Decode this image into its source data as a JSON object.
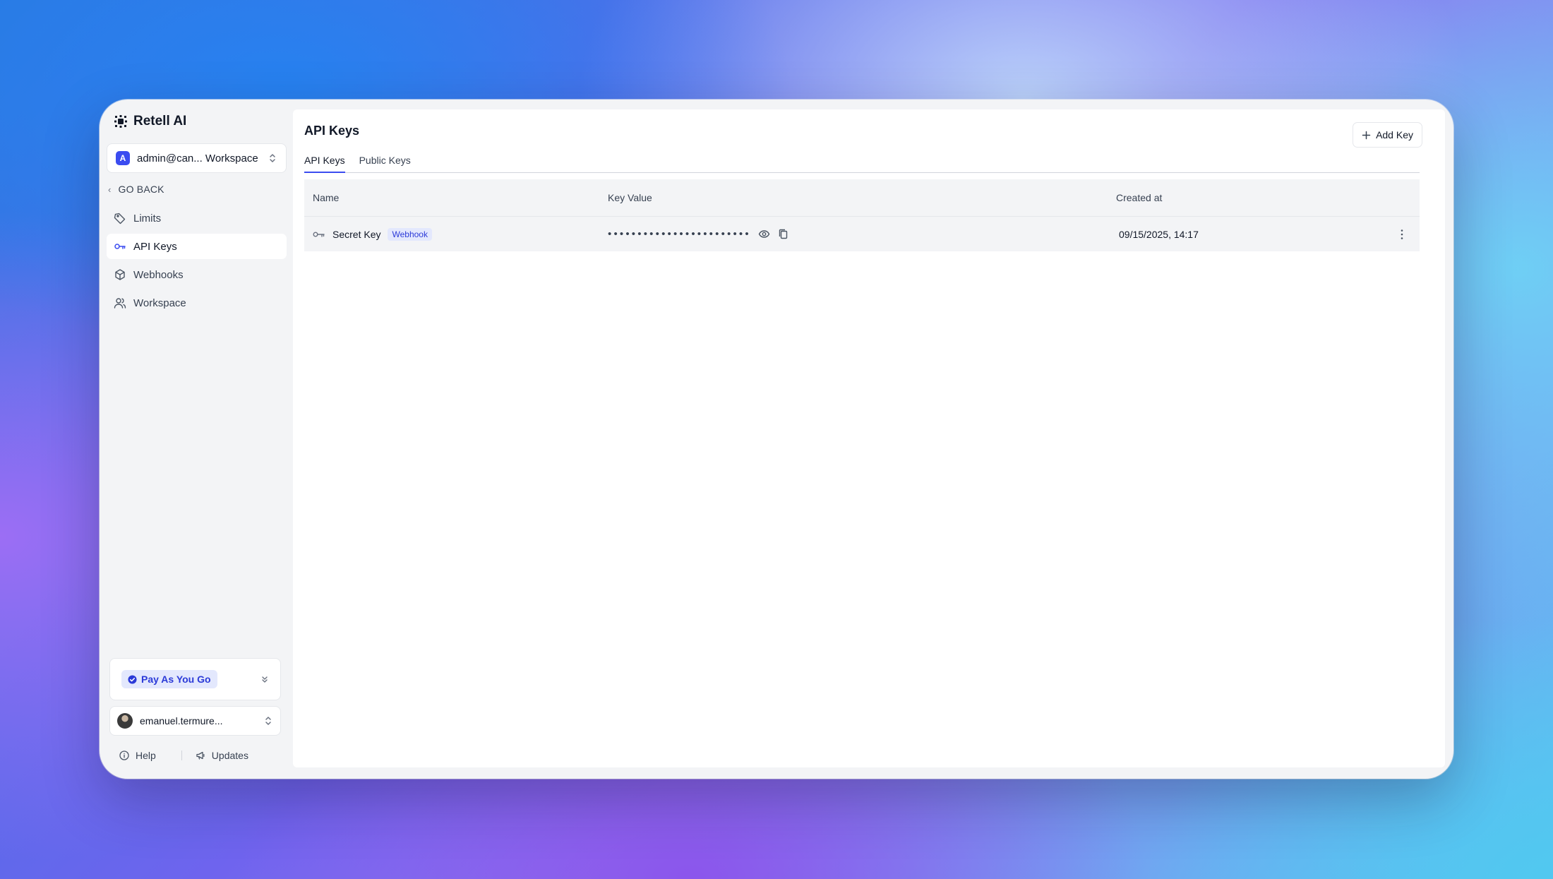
{
  "app": {
    "name": "Retell AI"
  },
  "workspace": {
    "avatar_letter": "A",
    "label": "admin@can... Workspace"
  },
  "sidebar": {
    "go_back": "GO BACK",
    "items": [
      {
        "label": "Limits",
        "icon": "tag-icon",
        "active": false
      },
      {
        "label": "API Keys",
        "icon": "key-icon",
        "active": true
      },
      {
        "label": "Webhooks",
        "icon": "cube-icon",
        "active": false
      },
      {
        "label": "Workspace",
        "icon": "users-icon",
        "active": false
      }
    ]
  },
  "plan": {
    "label": "Pay As You Go"
  },
  "user": {
    "name": "emanuel.termure..."
  },
  "footer": {
    "help": "Help",
    "updates": "Updates"
  },
  "main": {
    "title": "API Keys",
    "add_button": "Add Key",
    "tabs": [
      {
        "label": "API Keys",
        "active": true
      },
      {
        "label": "Public Keys",
        "active": false
      }
    ],
    "table": {
      "columns": [
        "Name",
        "Key Value",
        "Created at"
      ],
      "rows": [
        {
          "name": "Secret Key",
          "badge": "Webhook",
          "key_masked": "••••••••••••••••••••••••",
          "created_at": "09/15/2025, 14:17"
        }
      ]
    }
  },
  "colors": {
    "accent": "#3b4cf0",
    "badge_bg": "#e3e8fd",
    "badge_text": "#2b3ad8"
  }
}
